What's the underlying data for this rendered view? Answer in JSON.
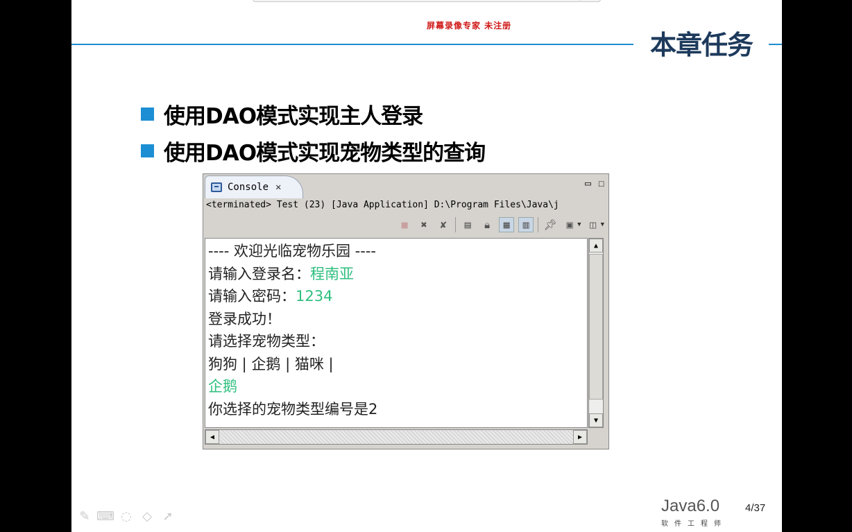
{
  "recorder_watermark": "屏幕录像专家  未注册",
  "chapter_title": "本章任务",
  "bullets": [
    "使用DAO模式实现主人登录",
    "使用DAO模式实现宠物类型的查询"
  ],
  "console": {
    "tab_label": "Console",
    "tab_close_icon": "close-icon",
    "status": "<terminated> Test (23) [Java Application] D:\\Program Files\\Java\\j",
    "toolbar_icons": [
      "terminate-icon",
      "remove-launch-icon",
      "remove-all-terminated-icon",
      "clear-console-icon",
      "scroll-lock-icon",
      "show-on-stdout-icon",
      "show-on-stderr-icon",
      "pin-console-icon",
      "display-console-icon",
      "open-console-icon"
    ],
    "lines": {
      "l1": "---- 欢迎光临宠物乐园 ----",
      "l2_prompt": "请输入登录名：",
      "l2_input": "程南亚",
      "l3_prompt": "请输入密码：",
      "l3_input": "1234",
      "l4": "登录成功！",
      "l5": "请选择宠物类型：",
      "l6": "狗狗 | 企鹅 | 猫咪 |",
      "l7_input": "企鹅",
      "l8": "你选择的宠物类型编号是2"
    },
    "input_color": "#2fbf7f"
  },
  "footer": {
    "brand_name": "Java6.0",
    "brand_sub": "软件工程师",
    "page": "4/37",
    "tools": [
      "pen-icon",
      "keyboard-icon",
      "eraser-icon",
      "highlighter-icon",
      "pointer-icon"
    ]
  },
  "colors": {
    "accent": "#1f8ccf",
    "title": "#1d3a5c",
    "watermark": "#d01818"
  }
}
